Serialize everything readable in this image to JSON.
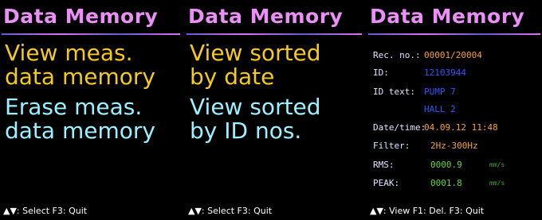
{
  "panel1": {
    "title": "Data Memory",
    "items": [
      {
        "line1": "View meas.",
        "line2": "data memory"
      },
      {
        "line1": "Erase meas.",
        "line2": "data memory"
      }
    ],
    "footer": "▲▼: Select  F3: Quit"
  },
  "panel2": {
    "title": "Data Memory",
    "items": [
      {
        "line1": "View sorted",
        "line2": "by date"
      },
      {
        "line1": "View sorted",
        "line2": "by ID nos."
      }
    ],
    "footer": "▲▼: Select  F3: Quit"
  },
  "panel3": {
    "title": "Data Memory",
    "fields": {
      "rec_label": "Rec. no.:",
      "rec_value": "00001/20004",
      "id_label": "ID:",
      "id_value": "12103944",
      "idtext_label": "ID text:",
      "idtext_value1": "PUMP 7",
      "idtext_value2": "HALL 2",
      "date_label": "Date/time:",
      "date_value": "04.09.12 11:48",
      "filter_label": "Filter:",
      "filter_value": "2Hz-300Hz",
      "rms_label": "RMS:",
      "rms_value": "0000.9",
      "rms_unit": "mm/s",
      "peak_label": "PEAK:",
      "peak_value": "0001.8",
      "peak_unit": "mm/s"
    },
    "footer": "▲▼: View  F1: Del.  F3: Quit"
  },
  "colors": {
    "title": "#e98ff6",
    "menu_selected": "#f6ca1d",
    "menu_normal": "#9df0ff",
    "value": "#f5a13b"
  }
}
